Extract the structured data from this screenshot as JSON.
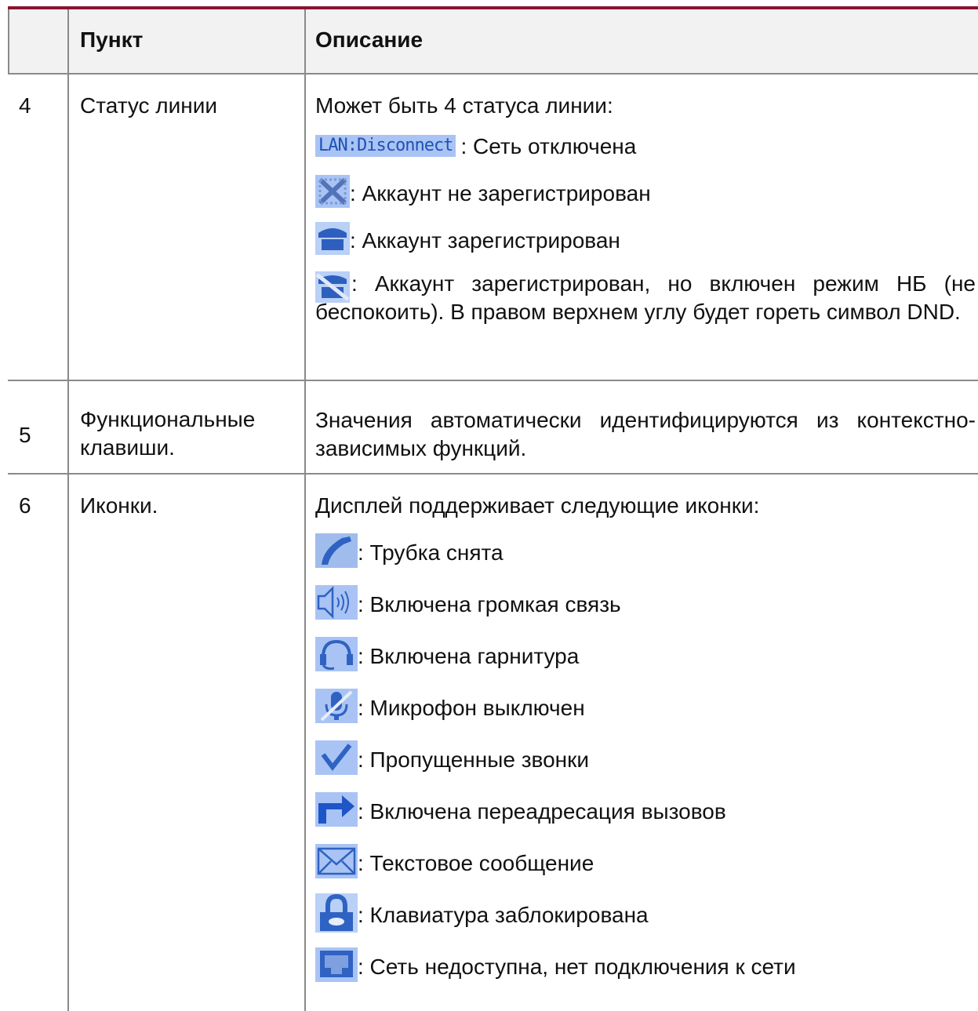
{
  "table": {
    "headers": [
      "Пункт",
      "Описание"
    ],
    "rows": [
      {
        "num": "4",
        "item": "Статус линии",
        "intro": "Может быть 4 статуса линии:",
        "entries": [
          {
            "icon": "lan-disconnect-badge",
            "badge": "LAN:Disconnect",
            "text": ": Сеть отключена"
          },
          {
            "icon": "account-unregistered-icon",
            "text": ": Аккаунт не зарегистрирован"
          },
          {
            "icon": "account-registered-icon",
            "text": ": Аккаунт зарегистрирован"
          },
          {
            "icon": "account-dnd-icon",
            "text": ": Аккаунт зарегистрирован, но включен режим НБ (не беспокоить). В правом верхнем углу будет гореть символ DND."
          }
        ]
      },
      {
        "num": "5",
        "item_lines": [
          "Функциональные",
          "клавиши."
        ],
        "desc": "Значения автоматически идентифицируются из контекстно-зависимых функций."
      },
      {
        "num": "6",
        "item": "Иконки.",
        "intro": "Дисплей поддерживает следующие иконки:",
        "entries": [
          {
            "icon": "handset-icon",
            "text": ": Трубка снята"
          },
          {
            "icon": "speaker-icon",
            "text": ": Включена громкая связь"
          },
          {
            "icon": "headset-icon",
            "text": ": Включена гарнитура"
          },
          {
            "icon": "mic-muted-icon",
            "text": ": Микрофон выключен"
          },
          {
            "icon": "missed-calls-icon",
            "text": ": Пропущенные звонки"
          },
          {
            "icon": "call-forward-icon",
            "text": ": Включена переадресация вызовов"
          },
          {
            "icon": "message-icon",
            "text": ": Текстовое сообщение"
          },
          {
            "icon": "lock-icon",
            "text": ": Клавиатура заблокирована"
          },
          {
            "icon": "network-unavailable-icon",
            "text": ": Сеть недоступна, нет подключения к сети"
          }
        ]
      }
    ]
  },
  "colors": {
    "top_rule": "#8a1330",
    "header_bg": "#f2f2f2",
    "icon_bg": "#9fb8eb",
    "icon_fg": "#1f52b4"
  }
}
